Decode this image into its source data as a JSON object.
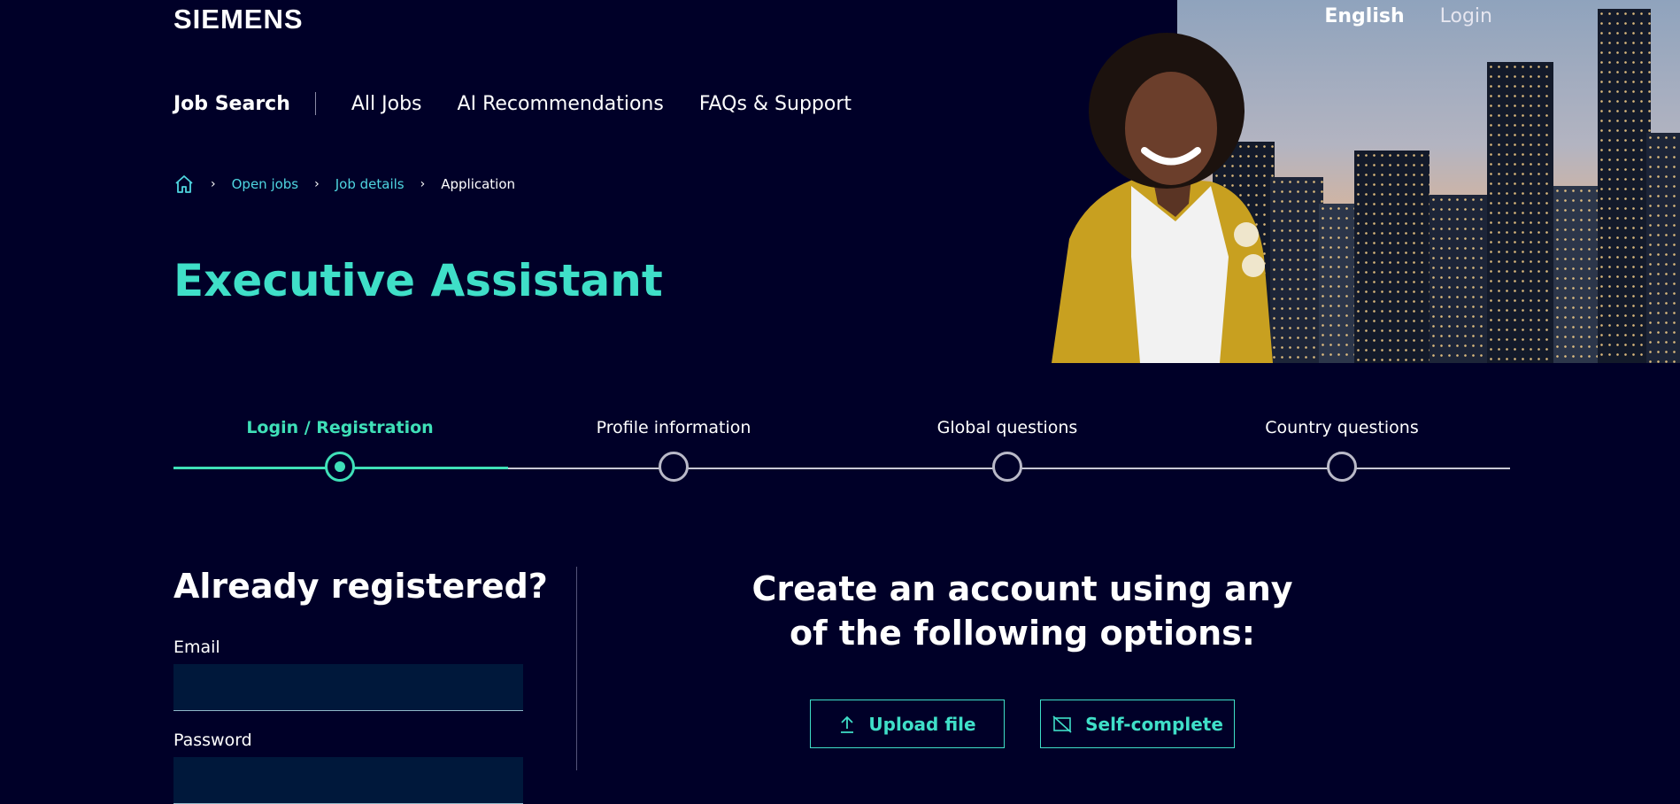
{
  "brand": {
    "logo_text": "SIEMENS"
  },
  "top_links": {
    "language": "English",
    "login": "Login"
  },
  "nav": {
    "primary": "Job Search",
    "items": [
      "All Jobs",
      "AI Recommendations",
      "FAQs & Support"
    ]
  },
  "breadcrumb": {
    "home_icon": "home-icon",
    "items": [
      {
        "label": "Open jobs"
      },
      {
        "label": "Job details"
      },
      {
        "label": "Application"
      }
    ]
  },
  "job": {
    "title": "Executive Assistant"
  },
  "stepper": {
    "steps": [
      {
        "label": "Login / Registration",
        "state": "active"
      },
      {
        "label": "Profile information",
        "state": "pending"
      },
      {
        "label": "Global questions",
        "state": "pending"
      },
      {
        "label": "Country questions",
        "state": "pending"
      }
    ]
  },
  "login_form": {
    "title": "Already registered?",
    "email_label": "Email",
    "email_value": "",
    "password_label": "Password",
    "password_value": ""
  },
  "create_account": {
    "title_line1": "Create an account using any",
    "title_line2": "of the following options:",
    "upload_label": "Upload file",
    "self_complete_label": "Self-complete"
  },
  "colors": {
    "background": "#000028",
    "accent": "#3fdfc8",
    "link": "#4fd6e0",
    "stepper_active": "#3fe0b8"
  }
}
